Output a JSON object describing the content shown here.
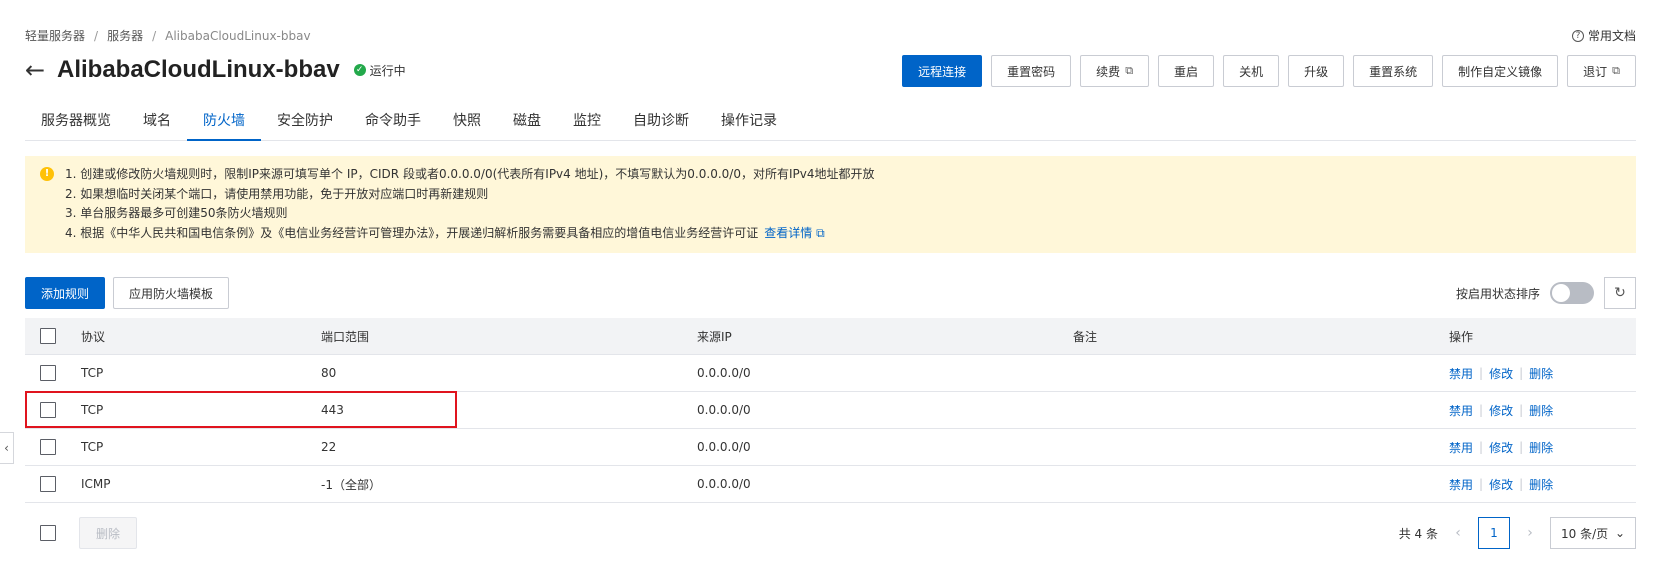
{
  "breadcrumb": [
    "轻量服务器",
    "服务器",
    "AlibabaCloudLinux-bbav"
  ],
  "breadcrumb_sep": "/",
  "help_doc": "常用文档",
  "title": "AlibabaCloudLinux-bbav",
  "status": "运行中",
  "actions": [
    "远程连接",
    "重置密码",
    "续费",
    "重启",
    "关机",
    "升级",
    "重置系统",
    "制作自定义镜像",
    "退订"
  ],
  "tabs": [
    "服务器概览",
    "域名",
    "防火墙",
    "安全防护",
    "命令助手",
    "快照",
    "磁盘",
    "监控",
    "自助诊断",
    "操作记录"
  ],
  "active_tab": "防火墙",
  "notice": {
    "lines": [
      "1. 创建或修改防火墙规则时，限制IP来源可填写单个 IP，CIDR 段或者0.0.0.0/0(代表所有IPv4 地址)，不填写默认为0.0.0.0/0，对所有IPv4地址都开放",
      "2. 如果想临时关闭某个端口，请使用禁用功能，免于开放对应端口时再新建规则",
      "3. 单台服务器最多可创建50条防火墙规则",
      "4. 根据《中华人民共和国电信条例》及《电信业务经营许可管理办法》，开展递归解析服务需要具备相应的增值电信业务经营许可证"
    ],
    "link": "查看详情"
  },
  "toolbar": {
    "add_rule": "添加规则",
    "apply_template": "应用防火墙模板",
    "sort_label": "按启用状态排序"
  },
  "table": {
    "headers": {
      "protocol": "协议",
      "port": "端口范围",
      "source": "来源IP",
      "note": "备注",
      "ops": "操作"
    },
    "rows": [
      {
        "protocol": "TCP",
        "port": "80",
        "source": "0.0.0.0/0",
        "note": ""
      },
      {
        "protocol": "TCP",
        "port": "443",
        "source": "0.0.0.0/0",
        "note": ""
      },
      {
        "protocol": "TCP",
        "port": "22",
        "source": "0.0.0.0/0",
        "note": ""
      },
      {
        "protocol": "ICMP",
        "port": "-1（全部）",
        "source": "0.0.0.0/0",
        "note": ""
      }
    ],
    "ops": {
      "disable": "禁用",
      "edit": "修改",
      "delete": "删除"
    }
  },
  "footer": {
    "delete": "删除",
    "total": "共 4 条",
    "page": "1",
    "page_size": "10 条/页"
  },
  "colors": {
    "primary": "#0064c8",
    "notice_bg": "#fff7d9",
    "running": "#23a94b",
    "highlight": "#e0141e"
  }
}
